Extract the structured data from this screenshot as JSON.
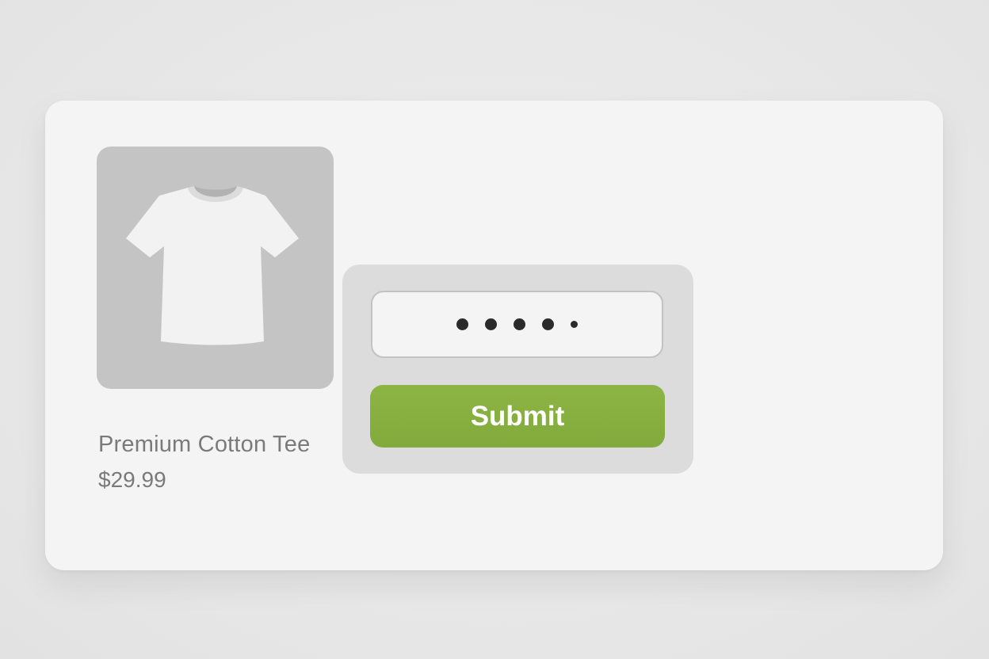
{
  "product": {
    "name": "Premium Cotton Tee",
    "price": "$29.99",
    "image_icon": "tshirt-icon"
  },
  "login": {
    "password_masked_length": 5
  },
  "submit": {
    "label": "Submit",
    "color": "#86ae40"
  },
  "colors": {
    "background": "#e8e8e8",
    "card": "#f4f4f4",
    "image_placeholder": "#c4c4c4",
    "panel": "#dcdcdc",
    "text_muted": "#7a7a7a"
  }
}
